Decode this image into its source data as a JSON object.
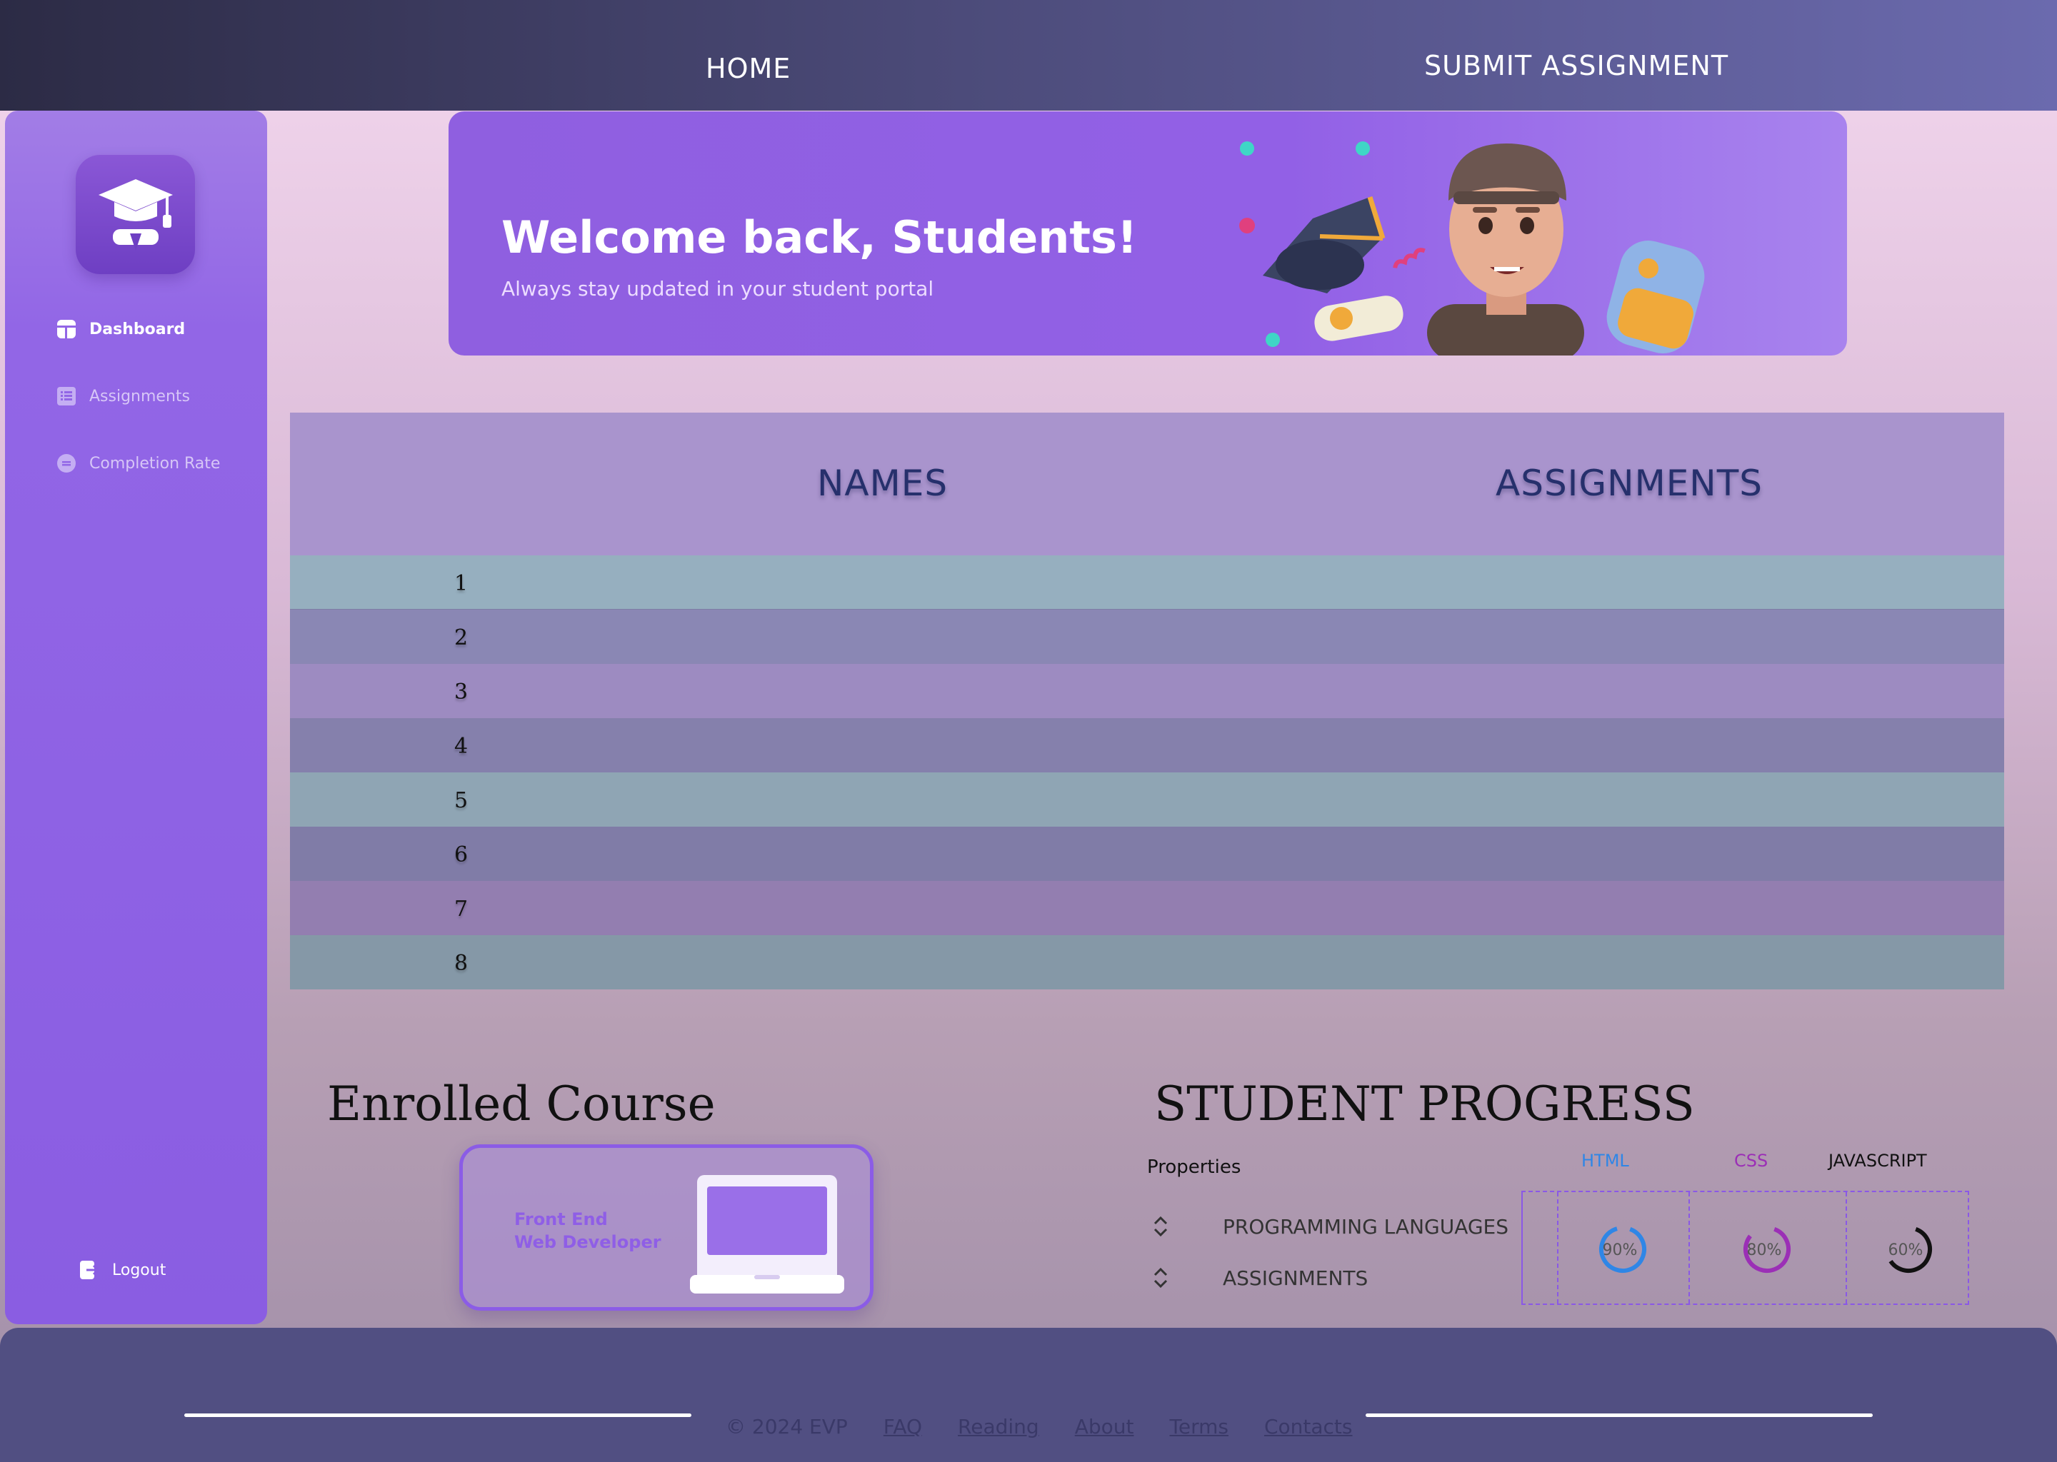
{
  "nav": {
    "home": "HOME",
    "submit": "SUBMIT ASSIGNMENT"
  },
  "sidebar": {
    "items": [
      {
        "label": "Dashboard",
        "icon": "dashboard-icon",
        "active": true
      },
      {
        "label": "Assignments",
        "icon": "list-icon",
        "active": false
      },
      {
        "label": "Completion Rate",
        "icon": "circle-icon",
        "active": false
      }
    ],
    "logout": "Logout"
  },
  "banner": {
    "title": "Welcome back, Students!",
    "subtitle": "Always stay updated in your student portal"
  },
  "table": {
    "headers": [
      "NAMES",
      "ASSIGNMENTS"
    ],
    "rows": [
      "1",
      "2",
      "3",
      "4",
      "5",
      "6",
      "7",
      "8"
    ]
  },
  "enrolled": {
    "title": "Enrolled Course",
    "course_line1": "Front End",
    "course_line2": "Web Developer"
  },
  "progress": {
    "title": "STUDENT PROGRESS",
    "properties_label": "Properties",
    "properties": [
      "PROGRAMMING LANGUAGES",
      "ASSIGNMENTS"
    ],
    "languages": [
      {
        "name": "HTML",
        "value": "90%",
        "fraction": 0.9,
        "color": "#2f86e6"
      },
      {
        "name": "CSS",
        "value": "80%",
        "fraction": 0.8,
        "color": "#9b2fb6"
      },
      {
        "name": "JAVASCRIPT",
        "value": "60%",
        "fraction": 0.6,
        "color": "#111111"
      }
    ]
  },
  "footer": {
    "copyright": "© 2024 EVP",
    "links": [
      "FAQ",
      "Reading",
      "About",
      "Terms",
      "Contacts"
    ]
  },
  "colors": {
    "accent": "#9260e6",
    "header_text": "#26306c",
    "footer_bg": "#514f82"
  }
}
